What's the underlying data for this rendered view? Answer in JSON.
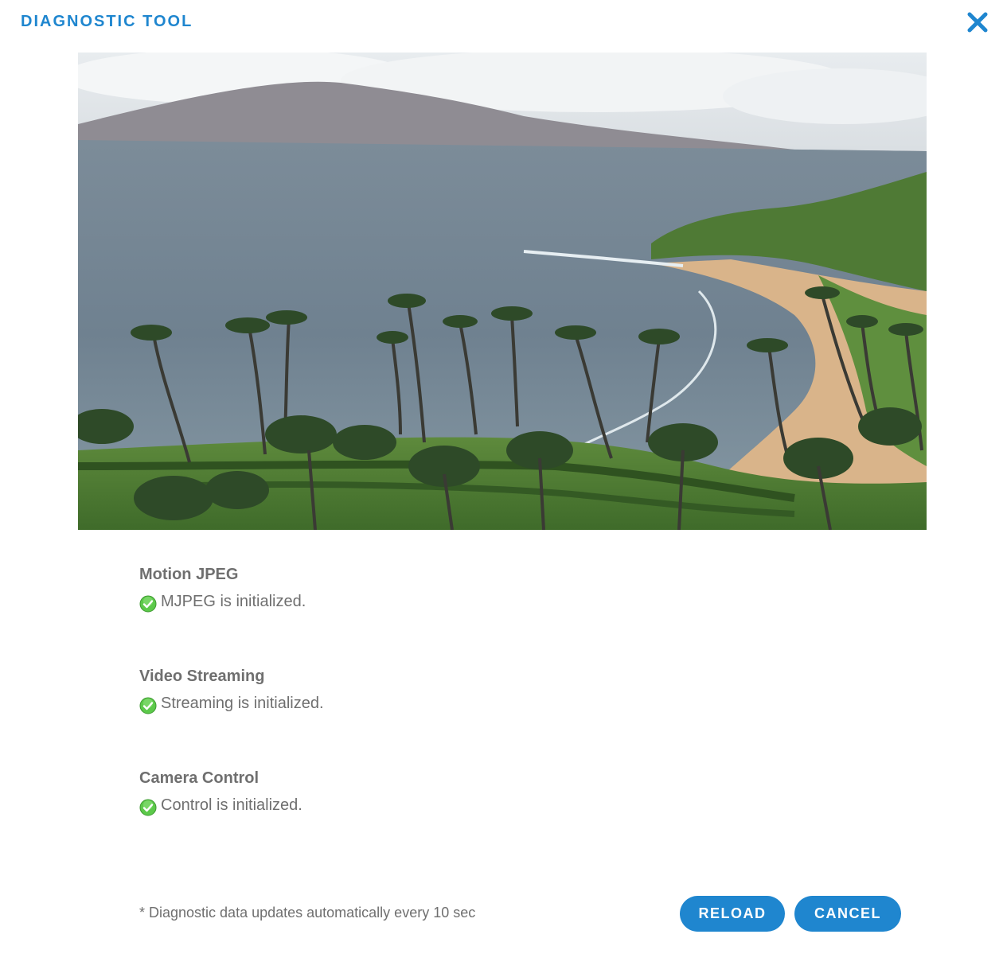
{
  "dialog": {
    "title": "DIAGNOSTIC TOOL",
    "close_icon": "close-icon"
  },
  "sections": [
    {
      "heading": "Motion JPEG",
      "status": "MJPEG is initialized.",
      "icon": "check-circle-icon",
      "state": "ok"
    },
    {
      "heading": "Video Streaming",
      "status": "Streaming is initialized.",
      "icon": "check-circle-icon",
      "state": "ok"
    },
    {
      "heading": "Camera Control",
      "status": "Control is initialized.",
      "icon": "check-circle-icon",
      "state": "ok"
    }
  ],
  "footer": {
    "note": "* Diagnostic data updates automatically every 10 sec",
    "reload_label": "RELOAD",
    "cancel_label": "CANCEL"
  },
  "colors": {
    "accent": "#1f86cf",
    "text": "#6f6f6f",
    "success": "#5cc94a"
  }
}
